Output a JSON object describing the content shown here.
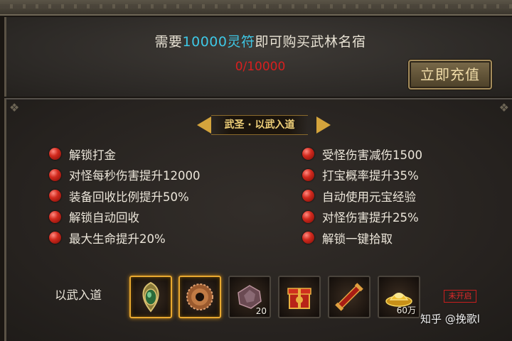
{
  "top": {
    "need_prefix": "需要",
    "need_amount": "10000灵符",
    "need_suffix": "即可购买武林名宿",
    "progress": "0/10000",
    "recharge_label": "立即充值",
    "colors": {
      "highlight": "#3ec8e6",
      "progress": "#d81f1f"
    }
  },
  "bottom": {
    "title": "武圣 · 以武入道",
    "left_attrs": [
      "解锁打金",
      "对怪每秒伤害提升12000",
      "装备回收比例提升50%",
      "解锁自动回收",
      "最大生命提升20%"
    ],
    "right_attrs": [
      "受怪伤害减伤1500",
      "打宝概率提升35%",
      "自动使用元宝经验",
      "对怪伤害提升25%",
      "解锁一键拾取"
    ],
    "items_label": "以武入道",
    "items": [
      {
        "icon": "jade-pendant-icon",
        "count": "",
        "highlighted": true
      },
      {
        "icon": "bronze-ring-icon",
        "count": "",
        "highlighted": true
      },
      {
        "icon": "gem-ore-icon",
        "count": "20",
        "highlighted": false
      },
      {
        "icon": "red-gift-box-icon",
        "count": "",
        "highlighted": false
      },
      {
        "icon": "red-scroll-icon",
        "count": "",
        "highlighted": false
      },
      {
        "icon": "gold-ingot-icon",
        "count": "60万",
        "highlighted": false
      }
    ],
    "status_badge": "未开启"
  },
  "watermark": "知乎 @挽歌l"
}
